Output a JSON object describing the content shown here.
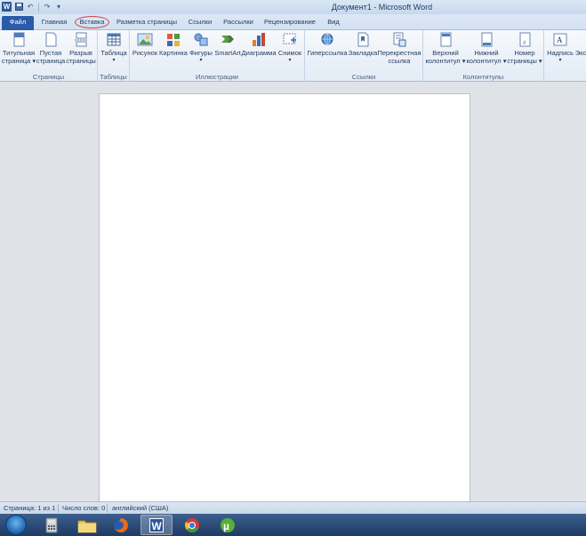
{
  "window": {
    "title": "Документ1 - Microsoft Word"
  },
  "qat": {
    "logo": "W",
    "undo": "↶",
    "redo": "↷",
    "customize": "▾"
  },
  "tabs": [
    {
      "label": "Файл"
    },
    {
      "label": "Главная"
    },
    {
      "label": "Вставка"
    },
    {
      "label": "Разметка страницы"
    },
    {
      "label": "Ссылки"
    },
    {
      "label": "Рассылки"
    },
    {
      "label": "Рецензирование"
    },
    {
      "label": "Вид"
    }
  ],
  "ribbon": {
    "groups": {
      "pages": "Страницы",
      "tables": "Таблицы",
      "illustrations": "Иллюстрации",
      "links": "Ссылки",
      "headers": "Колонтитулы"
    },
    "buttons": {
      "cover_page": [
        "Титульная",
        "страница ▾"
      ],
      "blank_page": [
        "Пустая",
        "страница"
      ],
      "page_break": [
        "Разрыв",
        "страницы"
      ],
      "table": [
        "Таблица",
        "▾"
      ],
      "picture": [
        "Рисунок"
      ],
      "clipart": [
        "Картинка"
      ],
      "shapes": [
        "Фигуры",
        "▾"
      ],
      "smartart": [
        "SmartArt"
      ],
      "chart": [
        "Диаграмма"
      ],
      "screenshot": [
        "Снимок",
        "▾"
      ],
      "hyperlink": [
        "Гиперссылка"
      ],
      "bookmark": [
        "Закладка"
      ],
      "crossref": [
        "Перекрестная",
        "ссылка"
      ],
      "header": [
        "Верхний",
        "колонтитул ▾"
      ],
      "footer": [
        "Нижний",
        "колонтитул ▾"
      ],
      "page_number": [
        "Номер",
        "страницы ▾"
      ],
      "textbox": [
        "Надпись",
        "▾"
      ],
      "express": [
        "Экс"
      ]
    }
  },
  "status": {
    "page": "Страница: 1 из 1",
    "words": "Число слов: 0",
    "language": "английский (США)"
  },
  "taskbar": {
    "word_label": "W"
  }
}
